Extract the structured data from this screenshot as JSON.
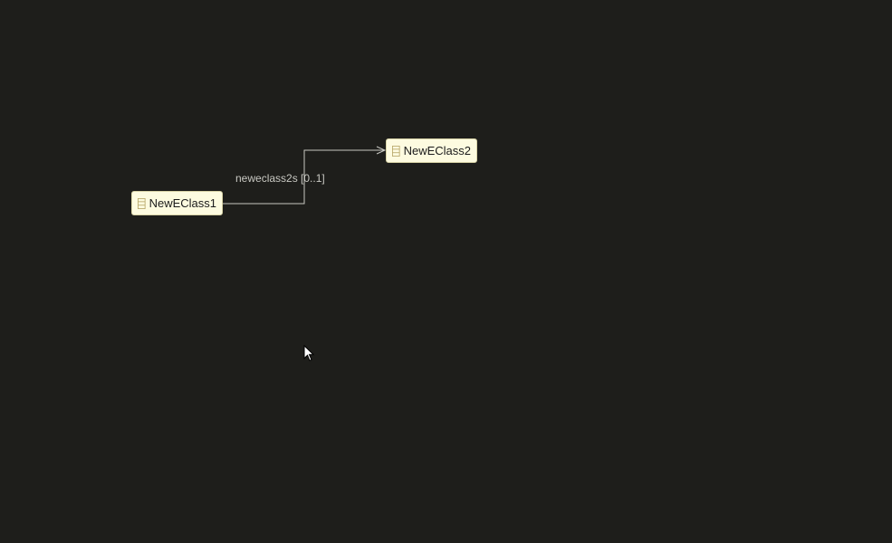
{
  "diagram": {
    "nodes": [
      {
        "name": "NewEClass1",
        "icon": "eclass-icon"
      },
      {
        "name": "NewEClass2",
        "icon": "eclass-icon"
      }
    ],
    "edge": {
      "label": "neweclass2s [0..1]",
      "icon": "arrow-head-icon"
    }
  },
  "colors": {
    "background": "#1e1e1b",
    "node_fill": "#fdfbe0",
    "node_border": "#d9d4a8",
    "edge": "#c8c8c2",
    "icon": "#b8a86a"
  },
  "pointer": {
    "icon": "mouse-cursor-icon"
  }
}
